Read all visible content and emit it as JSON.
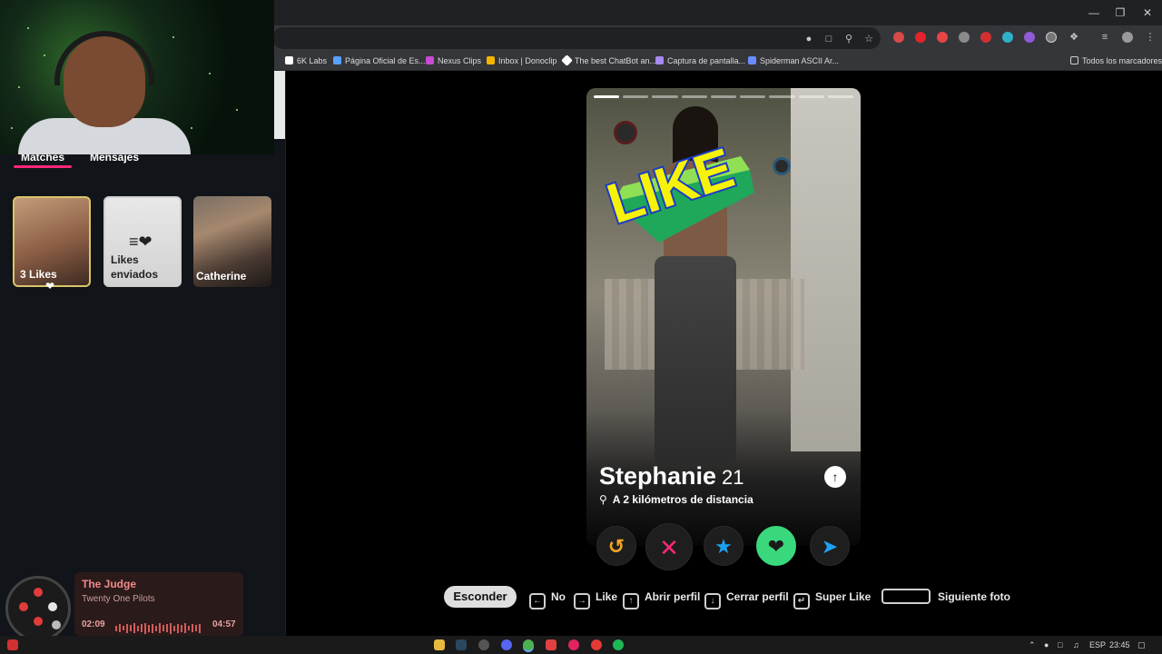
{
  "browser": {
    "bookmarks": [
      "6K Labs",
      "Página Oficial de Es...",
      "Nexus Clips",
      "Inbox | Donoclip",
      "The best ChatBot an...",
      "Captura de pantalla...",
      "Spiderman ASCII Ar..."
    ],
    "all_bookmarks": "Todos los marcadores"
  },
  "sidebar": {
    "tabs": [
      "Matches",
      "Mensajes"
    ],
    "cards": [
      {
        "label": "3 Likes"
      },
      {
        "label": "Likes enviados"
      },
      {
        "label": "Catherine"
      }
    ]
  },
  "profile": {
    "name": "Stephanie",
    "age": "21",
    "distance": "A 2 kilómetros de distancia",
    "stamp": "LIKE",
    "photo_count": 9,
    "active_photo": 1
  },
  "actions": [
    "rewind",
    "nope",
    "super-like",
    "like",
    "boost"
  ],
  "shortcuts": {
    "hide": "Esconder",
    "no": "No",
    "like": "Like",
    "open_profile": "Abrir perfil",
    "close_profile": "Cerrar perfil",
    "super_like": "Super Like",
    "next_photo": "Siguiente foto"
  },
  "music": {
    "title": "The Judge",
    "artist": "Twenty One Pilots",
    "elapsed": "02:09",
    "total": "04:57",
    "progress": 0.44
  },
  "taskbar": {
    "language": "ESP",
    "time": "23:45"
  },
  "colors": {
    "brand_pink": "#fd267a",
    "like_green": "#3ad87c",
    "star_blue": "#1da1f2",
    "rewind_yellow": "#f5a623"
  }
}
